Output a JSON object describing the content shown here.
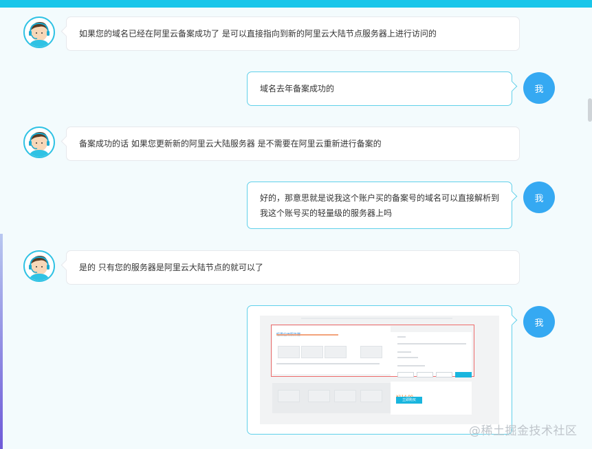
{
  "messages": [
    {
      "side": "agent",
      "text": "如果您的域名已经在阿里云备案成功了 是可以直接指向到新的阿里云大陆节点服务器上进行访问的"
    },
    {
      "side": "me",
      "avatar": "我",
      "text": "域名去年备案成功的"
    },
    {
      "side": "agent",
      "text": "备案成功的话 如果您更新新的阿里云大陆服务器 是不需要在阿里云重新进行备案的"
    },
    {
      "side": "me",
      "avatar": "我",
      "line1": "好的，那意思就是说我这个账户买的备案号的域名可以直接解析到",
      "line2": "我这个账号买的轻量级的服务器上吗"
    },
    {
      "side": "agent",
      "text": "是的 只有您的服务器是阿里云大陆节点的就可以了"
    },
    {
      "side": "me",
      "avatar": "我",
      "type": "image",
      "caption": "轻量应用服务器",
      "price": "¥114.00",
      "buy": "立即购买"
    }
  ],
  "watermark": "@稀土掘金技术社区",
  "colors": {
    "accent": "#19c6ea",
    "me_avatar": "#35a9f2",
    "bubble_border_me": "#5fd0ea"
  },
  "icons": {
    "agent_avatar": "headset-agent-avatar-icon"
  }
}
